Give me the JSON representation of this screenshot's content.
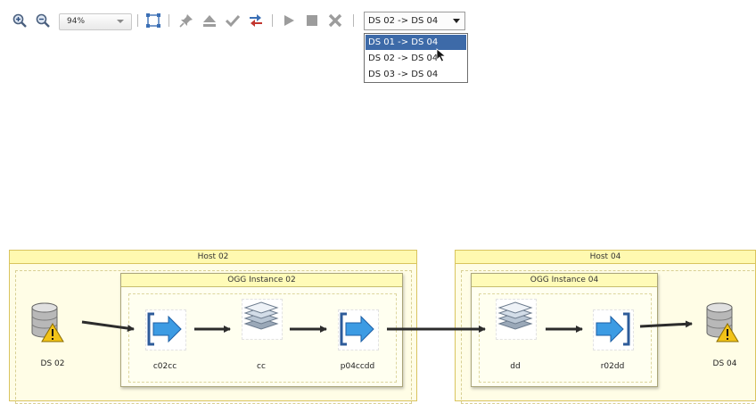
{
  "toolbar": {
    "zoom_value": "94%",
    "combo_selected": "DS 02 -> DS 04",
    "options": [
      "DS 01 -> DS 04",
      "DS 02 -> DS 04",
      "DS 03 -> DS 04"
    ],
    "highlighted_option_index": 0
  },
  "diagram": {
    "host_left_title": "Host 02",
    "host_right_title": "Host 04",
    "instance_left_title": "OGG Instance 02",
    "instance_right_title": "OGG Instance 04",
    "nodes": {
      "ds_src": "DS 02",
      "extract": "c02cc",
      "trail_cc": "cc",
      "pump": "p04ccdd",
      "trail_dd": "dd",
      "replicat": "r02dd",
      "ds_dst": "DS 04"
    }
  },
  "colors": {
    "accent_blue": "#3d6aa8",
    "host_border": "#d9c45e",
    "host_title_bg": "#fff9b0",
    "warning_yellow": "#f2c318"
  }
}
